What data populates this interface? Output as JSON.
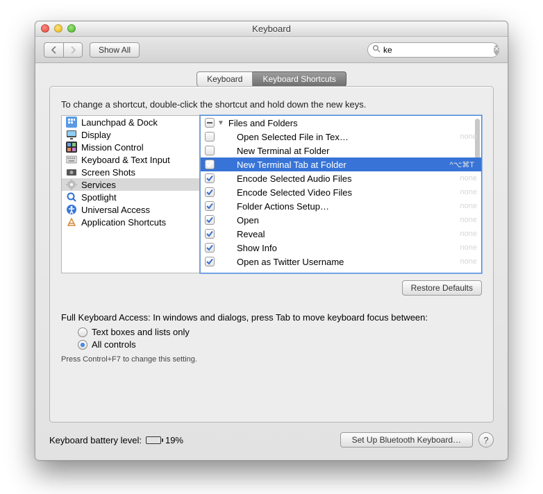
{
  "window": {
    "title": "Keyboard"
  },
  "toolbar": {
    "show_all_label": "Show All",
    "search_value": "ke"
  },
  "tabs": {
    "keyboard": "Keyboard",
    "shortcuts": "Keyboard Shortcuts"
  },
  "instructions": "To change a shortcut, double-click the shortcut and hold down the new keys.",
  "categories": [
    {
      "label": "Launchpad & Dock",
      "icon": "launchpad"
    },
    {
      "label": "Display",
      "icon": "display"
    },
    {
      "label": "Mission Control",
      "icon": "mission"
    },
    {
      "label": "Keyboard & Text Input",
      "icon": "keyboard"
    },
    {
      "label": "Screen Shots",
      "icon": "screenshots"
    },
    {
      "label": "Services",
      "icon": "services",
      "selected": true
    },
    {
      "label": "Spotlight",
      "icon": "spotlight"
    },
    {
      "label": "Universal Access",
      "icon": "universal"
    },
    {
      "label": "Application Shortcuts",
      "icon": "apps"
    }
  ],
  "group_header": "Files and Folders",
  "shortcuts": [
    {
      "checked": false,
      "label": "Open Selected File in Tex…",
      "shortcut": "none"
    },
    {
      "checked": false,
      "label": "New Terminal at Folder",
      "shortcut": ""
    },
    {
      "checked": true,
      "label": "New Terminal Tab at Folder",
      "shortcut": "^⌥⌘T",
      "selected": true
    },
    {
      "checked": true,
      "label": "Encode Selected Audio Files",
      "shortcut": "none"
    },
    {
      "checked": true,
      "label": "Encode Selected Video Files",
      "shortcut": "none"
    },
    {
      "checked": true,
      "label": "Folder Actions Setup…",
      "shortcut": "none"
    },
    {
      "checked": true,
      "label": "Open",
      "shortcut": "none"
    },
    {
      "checked": true,
      "label": "Reveal",
      "shortcut": "none"
    },
    {
      "checked": true,
      "label": "Show Info",
      "shortcut": "none"
    },
    {
      "checked": true,
      "label": "Open as Twitter Username",
      "shortcut": "none"
    }
  ],
  "restore_defaults": "Restore Defaults",
  "full_access_label": "Full Keyboard Access: In windows and dialogs, press Tab to move keyboard focus between:",
  "radio": {
    "opt1": "Text boxes and lists only",
    "opt2": "All controls"
  },
  "hint": "Press Control+F7 to change this setting.",
  "battery": {
    "label": "Keyboard battery level:",
    "percent_text": "19%",
    "percent": 19
  },
  "bluetooth_btn": "Set Up Bluetooth Keyboard…"
}
